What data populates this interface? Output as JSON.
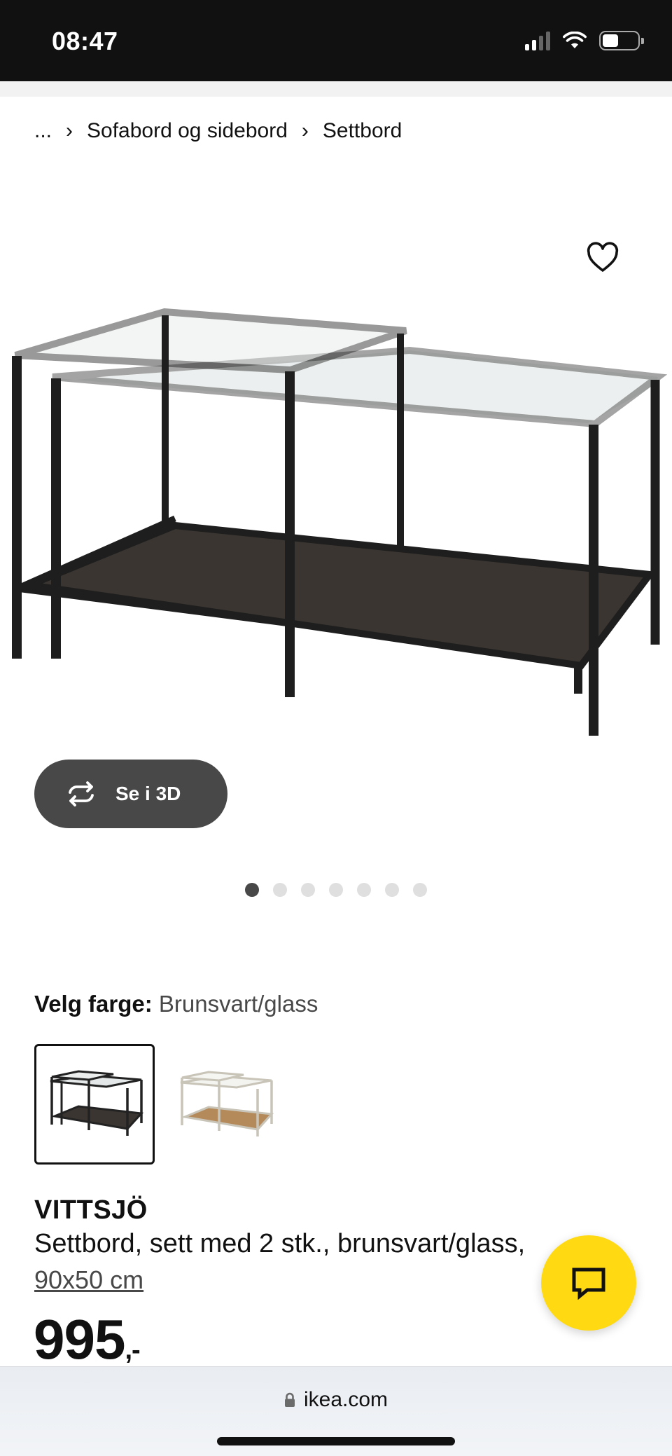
{
  "status_bar": {
    "time": "08:47"
  },
  "breadcrumb": {
    "ellipsis": "...",
    "items": [
      "Sofabord og sidebord",
      "Settbord"
    ]
  },
  "gallery": {
    "view_3d_label": "Se i 3D",
    "total_images": 7,
    "active_index": 0
  },
  "color_select": {
    "label": "Velg farge:",
    "value": "Brunsvart/glass"
  },
  "product": {
    "name": "VITTSJÖ",
    "description": "Settbord, sett med 2 stk., brunsvart/glass,",
    "size": "90x50 cm",
    "price": "995",
    "price_suffix": ",-"
  },
  "browser": {
    "url": "ikea.com"
  },
  "colors": {
    "status_bar": "#111111",
    "chat_button": "#ffd912",
    "button_3d": "#484848"
  }
}
